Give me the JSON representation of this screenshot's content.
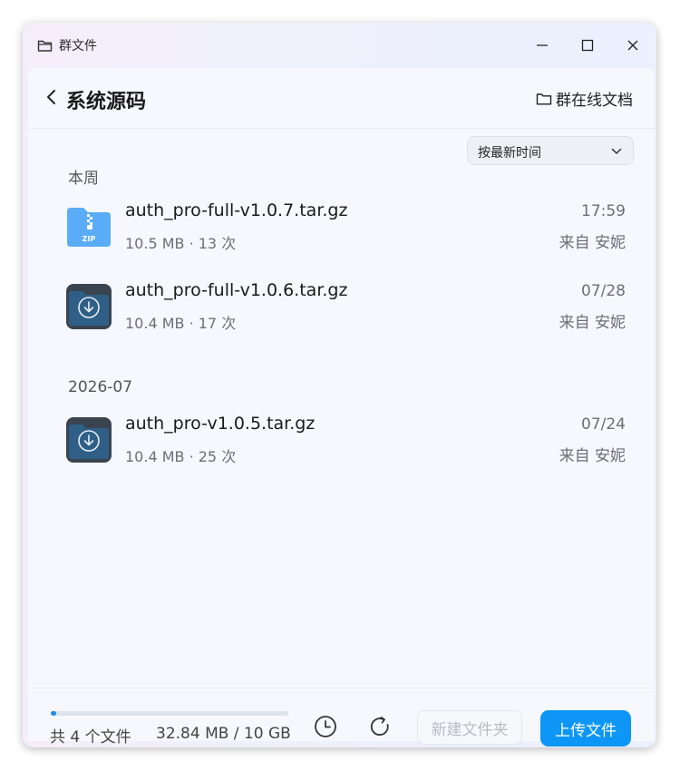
{
  "window": {
    "title": "群文件"
  },
  "header": {
    "title": "系统源码",
    "online_docs": "群在线文档"
  },
  "sort": {
    "label": "按最新时间"
  },
  "sections": [
    {
      "label": "本周",
      "files": [
        {
          "name": "auth_pro-full-v1.0.7.tar.gz",
          "meta": "10.5 MB · 13 次",
          "time": "17:59",
          "from": "来自 安妮",
          "icon": "zip-file-icon"
        },
        {
          "name": "auth_pro-full-v1.0.6.tar.gz",
          "meta": "10.4 MB · 17 次",
          "time": "07/28",
          "from": "来自 安妮",
          "icon": "download-file-icon"
        }
      ]
    },
    {
      "label": "2026-07",
      "files": [
        {
          "name": "auth_pro-v1.0.5.tar.gz",
          "meta": "10.4 MB · 25 次",
          "time": "07/24",
          "from": "来自 安妮",
          "icon": "download-file-icon"
        }
      ]
    }
  ],
  "footer": {
    "count": "共 4 个文件",
    "usage": "32.84 MB / 10 GB",
    "usage_fraction": 0.0032,
    "new_folder": "新建文件夹",
    "upload": "上传文件"
  },
  "colors": {
    "accent": "#0d96f6",
    "zip_icon": "#5aacf6",
    "download_icon": "#2f5f86"
  }
}
